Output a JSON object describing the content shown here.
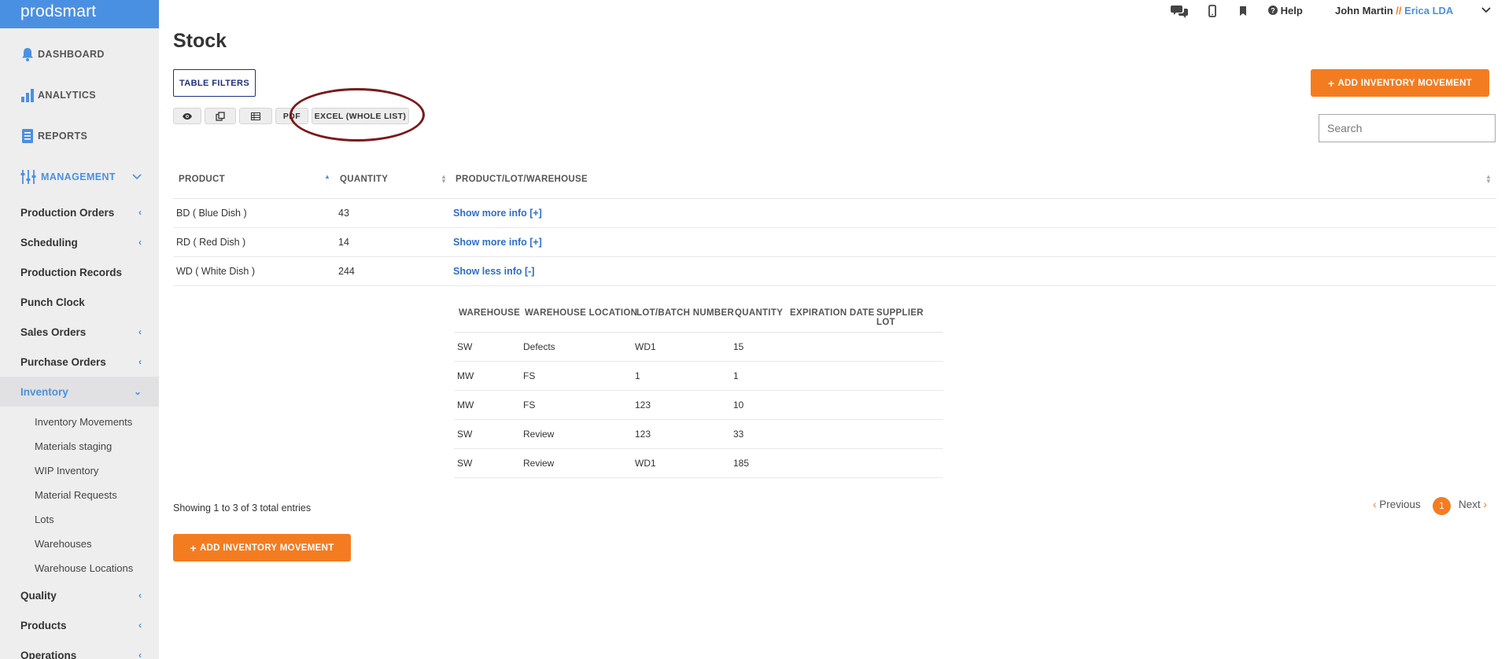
{
  "app": {
    "logo": "prodsmart"
  },
  "sidebar": {
    "top_items": [
      {
        "label": "DASHBOARD",
        "icon": "bell-icon"
      },
      {
        "label": "ANALYTICS",
        "icon": "bar-chart-icon"
      },
      {
        "label": "REPORTS",
        "icon": "document-icon"
      }
    ],
    "management": {
      "label": "MANAGEMENT",
      "icon": "sliders-icon"
    },
    "items": [
      {
        "label": "Production Orders",
        "arrow": "‹"
      },
      {
        "label": "Scheduling",
        "arrow": "‹"
      },
      {
        "label": "Production Records",
        "arrow": ""
      },
      {
        "label": "Punch Clock",
        "arrow": ""
      },
      {
        "label": "Sales Orders",
        "arrow": "‹"
      },
      {
        "label": "Purchase Orders",
        "arrow": "‹"
      },
      {
        "label": "Inventory",
        "arrow": "⌄"
      }
    ],
    "inventory_sub": [
      "Inventory Movements",
      "Materials staging",
      "WIP Inventory",
      "Material Requests",
      "Lots",
      "Warehouses",
      "Warehouse Locations"
    ],
    "bottom_items": [
      {
        "label": "Quality",
        "arrow": "‹"
      },
      {
        "label": "Products",
        "arrow": "‹"
      },
      {
        "label": "Operations",
        "arrow": "‹"
      }
    ]
  },
  "header": {
    "help": "Help",
    "user_name": "John Martin",
    "separator": "//",
    "company": "Erica LDA",
    "icons": [
      "chat-icon",
      "mobile-icon",
      "bookmark-icon",
      "help-icon",
      "chevron-down-icon"
    ]
  },
  "page": {
    "title": "Stock",
    "table_filters": "TABLE FILTERS",
    "add_movement": "ADD INVENTORY MOVEMENT",
    "search_placeholder": "Search",
    "export_buttons": {
      "pdf": "PDF",
      "excel": "EXCEL (WHOLE LIST)"
    }
  },
  "stock_table": {
    "columns": [
      "PRODUCT",
      "QUANTITY",
      "PRODUCT/LOT/WAREHOUSE"
    ],
    "rows": [
      {
        "product": "BD ( Blue Dish )",
        "quantity": "43",
        "info": "Show more info [+]"
      },
      {
        "product": "RD ( Red Dish )",
        "quantity": "14",
        "info": "Show more info [+]"
      },
      {
        "product": "WD ( White Dish )",
        "quantity": "244",
        "info": "Show less info [-]"
      }
    ]
  },
  "detail_table": {
    "columns": [
      "WAREHOUSE",
      "WAREHOUSE LOCATION",
      "LOT/BATCH NUMBER",
      "QUANTITY",
      "EXPIRATION DATE",
      "SUPPLIER LOT"
    ],
    "rows": [
      [
        "SW",
        "Defects",
        "WD1",
        "15",
        "",
        ""
      ],
      [
        "MW",
        "FS",
        "1",
        "1",
        "",
        ""
      ],
      [
        "MW",
        "FS",
        "123",
        "10",
        "",
        ""
      ],
      [
        "SW",
        "Review",
        "123",
        "33",
        "",
        ""
      ],
      [
        "SW",
        "Review",
        "WD1",
        "185",
        "",
        ""
      ]
    ]
  },
  "footer": {
    "showing": "Showing 1 to 3 of 3 total entries",
    "previous": "Previous",
    "next": "Next",
    "current_page": "1"
  },
  "colors": {
    "accent": "#4a90e2",
    "brand_orange": "#f47c20",
    "navy": "#1f2f7a",
    "highlight": "#7a1a1a"
  }
}
